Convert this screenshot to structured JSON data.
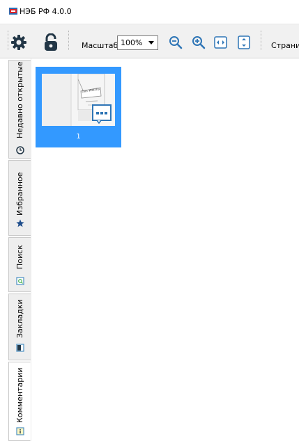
{
  "window": {
    "title": "НЭБ РФ 4.0.0"
  },
  "toolbar": {
    "settings_icon": "gear-icon",
    "lock_icon": "unlocked-padlock-icon",
    "zoom_label": "Масштаб",
    "zoom_value": "100%",
    "zoom_out_icon": "zoom-out-icon",
    "zoom_in_icon": "zoom-in-icon",
    "fit_width_icon": "fit-width-icon",
    "fit_height_icon": "fit-height-icon",
    "page_label": "Страни"
  },
  "sidebar": {
    "tabs": [
      {
        "label": "Недавно открытые",
        "icon": "clock-icon"
      },
      {
        "label": "Избранное",
        "icon": "star-icon"
      },
      {
        "label": "Поиск",
        "icon": "search-page-icon"
      },
      {
        "label": "Закладки",
        "icon": "bookmark-icon"
      },
      {
        "label": "Комментарии",
        "icon": "comment-icon"
      }
    ]
  },
  "thumbnails": [
    {
      "page_number": "1",
      "title_text": "Das Weichsel"
    }
  ],
  "colors": {
    "selection": "#3399ff",
    "toolbar_bg": "#f1f1f1",
    "icon_dark": "#223646",
    "icon_blue": "#2e75b6",
    "logo_red": "#d9242b",
    "logo_blue": "#2d6db3"
  }
}
